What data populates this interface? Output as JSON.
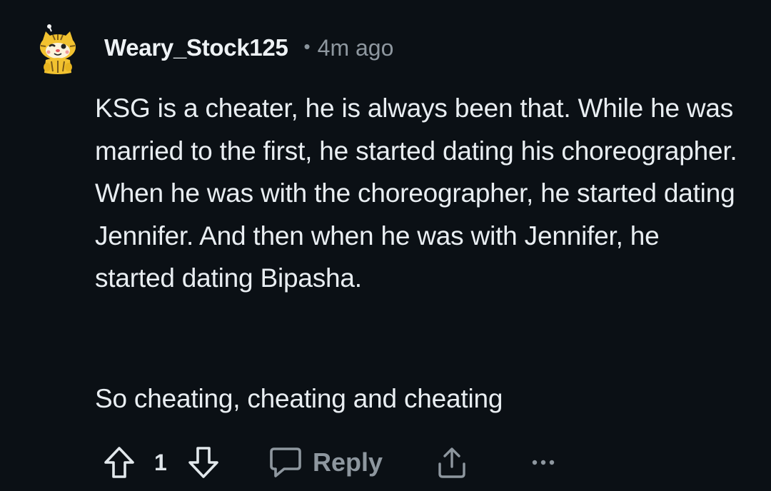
{
  "comment": {
    "username": "Weary_Stock125",
    "separator": "•",
    "timestamp": "4m ago",
    "paragraphs": [
      "KSG is a cheater, he is always been that. While he was married to the first, he started dating his choreographer. When he was with the choreographer, he started dating Jennifer. And then when he was with Jennifer, he started dating Bipasha.",
      "So cheating, cheating and cheating"
    ]
  },
  "actions": {
    "upvote_icon": "arrow-up-outline-icon",
    "score": "1",
    "downvote_icon": "arrow-down-outline-icon",
    "reply_icon": "speech-bubble-icon",
    "reply_label": "Reply",
    "share_icon": "share-upload-icon",
    "more_icon": "more-dots-icon"
  },
  "colors": {
    "background": "#0b1015",
    "text": "#e9eef2",
    "muted": "#8e979f",
    "avatar_yellow": "#f2c230"
  }
}
